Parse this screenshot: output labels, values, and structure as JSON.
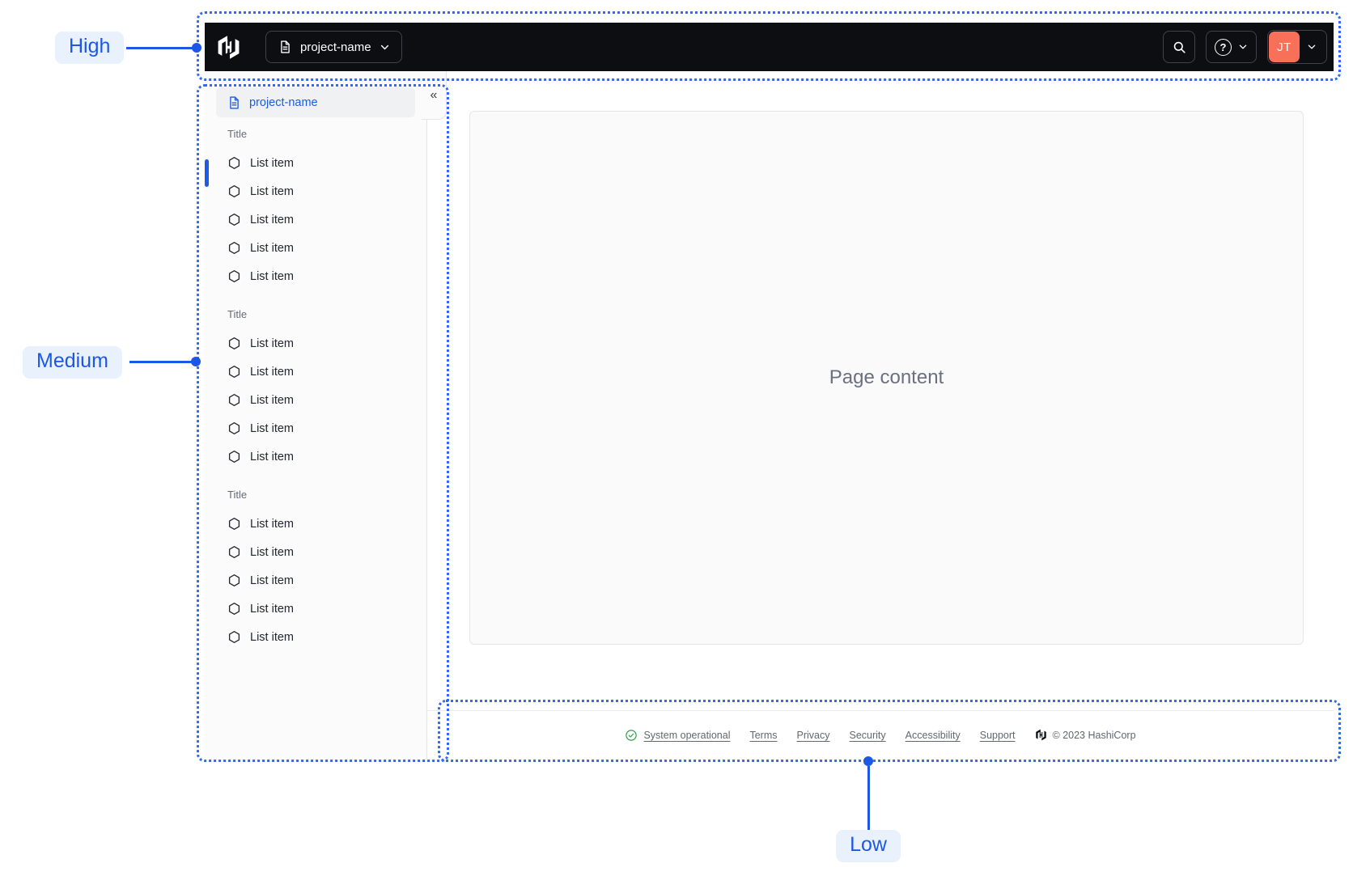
{
  "annotations": {
    "high": {
      "label": "High"
    },
    "medium": {
      "label": "Medium"
    },
    "low": {
      "label": "Low"
    }
  },
  "navbar": {
    "project_switcher": {
      "label": "project-name"
    },
    "help_glyph": "?",
    "user": {
      "initials": "JT"
    }
  },
  "sidebar": {
    "active_item": {
      "label": "project-name"
    },
    "collapse_glyph": "«",
    "sections": [
      {
        "title": "Title",
        "items": [
          "List item",
          "List item",
          "List item",
          "List item",
          "List item"
        ]
      },
      {
        "title": "Title",
        "items": [
          "List item",
          "List item",
          "List item",
          "List item",
          "List item"
        ]
      },
      {
        "title": "Title",
        "items": [
          "List item",
          "List item",
          "List item",
          "List item",
          "List item"
        ]
      }
    ]
  },
  "content": {
    "placeholder": "Page content"
  },
  "footer": {
    "status": {
      "label": "System operational"
    },
    "links": [
      "Terms",
      "Privacy",
      "Security",
      "Accessibility",
      "Support"
    ],
    "copyright": "© 2023 HashiCorp"
  },
  "colors": {
    "annotation_blue": "#1d57e5",
    "region_border_blue": "#2f6af0",
    "annotation_label_bg": "#e9f1fd",
    "navbar_bg": "#0d0e12",
    "avatar_orange": "#f8705a",
    "active_item_blue": "#1c5ae8",
    "status_green": "#2f9e44"
  }
}
